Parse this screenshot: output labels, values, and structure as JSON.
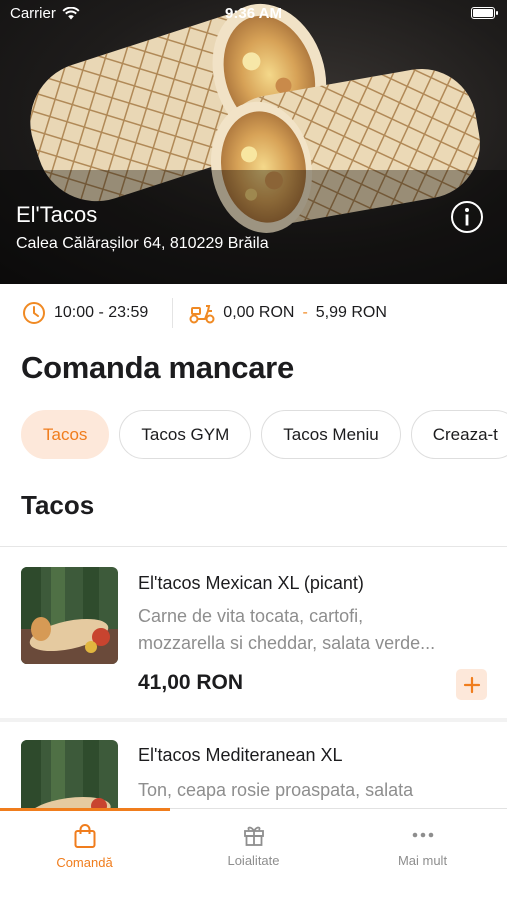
{
  "status_bar": {
    "carrier": "Carrier",
    "time": "9:36 AM"
  },
  "restaurant": {
    "name": "El'Tacos",
    "address": "Calea Călărașilor 64, 810229 Brăila"
  },
  "info": {
    "hours": "10:00 - 23:59",
    "delivery_min": "0,00 RON",
    "delivery_separator": "-",
    "delivery_max": "5,99 RON"
  },
  "page_title": "Comanda mancare",
  "categories": [
    {
      "label": "Tacos",
      "active": true
    },
    {
      "label": "Tacos GYM",
      "active": false
    },
    {
      "label": "Tacos Meniu",
      "active": false
    },
    {
      "label": "Creaza-t",
      "active": false
    }
  ],
  "section_title": "Tacos",
  "products": [
    {
      "name": "El'tacos Mexican XL (picant)",
      "desc_line1": "Carne de vita tocata, cartofi,",
      "desc_line2": "mozzarella si cheddar, salata verde...",
      "price": "41,00 RON"
    },
    {
      "name": "El'tacos Mediteranean XL",
      "desc_line1": "Ton, ceapa rosie proaspata, salata",
      "desc_line2": ""
    }
  ],
  "tabs": [
    {
      "label": "Comandă",
      "icon": "shopping-bag-icon",
      "active": true
    },
    {
      "label": "Loialitate",
      "icon": "gift-icon",
      "active": false
    },
    {
      "label": "Mai mult",
      "icon": "more-dots-icon",
      "active": false
    }
  ],
  "colors": {
    "accent": "#f07d1d",
    "accent_light": "#fde8da",
    "muted": "#8e8e8e"
  }
}
